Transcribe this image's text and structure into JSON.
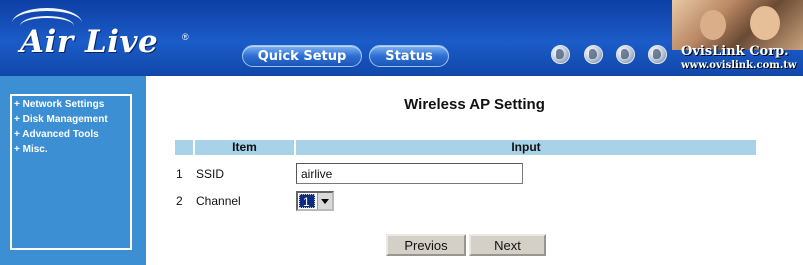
{
  "header": {
    "logo_text": "Air Live",
    "logo_mark": "®",
    "nav": {
      "quick_setup_label": "Quick Setup",
      "status_label": "Status"
    },
    "company_name": "OvisLink Corp.",
    "company_url": "www.ovislink.com.tw",
    "icons": [
      "globe-icon",
      "globe-icon",
      "globe-icon",
      "globe-icon"
    ]
  },
  "sidebar": {
    "items": [
      {
        "label": "+ Network Settings"
      },
      {
        "label": "+ Disk Management"
      },
      {
        "label": "+ Advanced Tools"
      },
      {
        "label": "+ Misc."
      }
    ]
  },
  "main": {
    "title": "Wireless AP Setting",
    "table": {
      "headers": {
        "item": "Item",
        "input": "Input"
      },
      "rows": [
        {
          "index": "1",
          "label": "SSID",
          "value": "airlive"
        },
        {
          "index": "2",
          "label": "Channel",
          "value": "1"
        }
      ]
    },
    "buttons": {
      "previous_label": "Previos",
      "next_label": "Next"
    }
  },
  "colors": {
    "header_blue": "#1b5cc8",
    "sidebar_blue": "#3d8fd4",
    "table_header": "#a8d2e8"
  }
}
